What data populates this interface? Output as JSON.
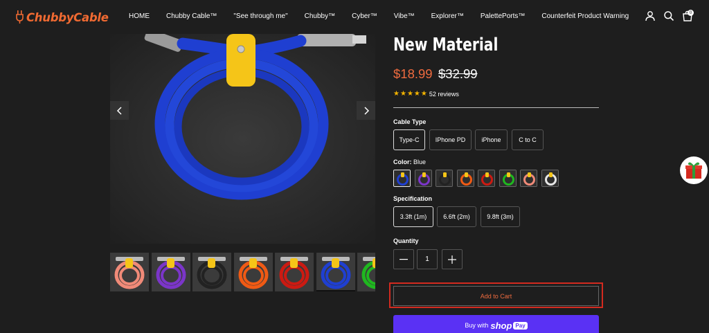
{
  "brand": {
    "name": "ChubbyCable",
    "accent": "#f06a32"
  },
  "nav": {
    "items": [
      "HOME",
      "Chubby Cable™",
      "\"See through me\"",
      "Chubby™",
      "Cyber™",
      "Vibe™",
      "Explorer™",
      "PalettePorts™",
      "Counterfeit Product Warning"
    ]
  },
  "header_icons": {
    "account": "user-icon",
    "search": "search-icon",
    "cart": "cart-icon",
    "cart_count": "0"
  },
  "product": {
    "title_line": "New Material",
    "sale_price": "$18.99",
    "compare_price": "$32.99",
    "rating": 5,
    "reviews": "52 reviews",
    "main_image_color": "#1f3fd1"
  },
  "cable_type": {
    "label": "Cable Type",
    "options": [
      "Type-C",
      "IPhone PD",
      "iPhone",
      "C to C"
    ],
    "selected": "Type-C"
  },
  "color": {
    "label": "Color:",
    "value": "Blue",
    "swatches": [
      "#1f3fd1",
      "#7b35c9",
      "#222222",
      "#f05a14",
      "#cc1a12",
      "#1fb81f",
      "#f08a78",
      "#e6e6e6"
    ]
  },
  "specification": {
    "label": "Specification",
    "options": [
      "3.3ft (1m)",
      "6.6ft (2m)",
      "9.8ft (3m)"
    ],
    "selected": "3.3ft (1m)"
  },
  "quantity": {
    "label": "Quantity",
    "value": "1",
    "minus": "–",
    "plus": "+"
  },
  "thumbnails": [
    "#f08a78",
    "#7b35c9",
    "#222222",
    "#f05a14",
    "#cc1a12",
    "#1f3fd1",
    "#1fb81f"
  ],
  "buttons": {
    "add_to_cart": "Add to Cart",
    "buy_with": "Buy with",
    "shop_word": "shop",
    "pay_word": "Pay"
  },
  "colors": {
    "sale": "#ef6b3f",
    "shop_pay": "#5a31f4",
    "highlight": "#d42a1f",
    "star": "#f5b400"
  }
}
